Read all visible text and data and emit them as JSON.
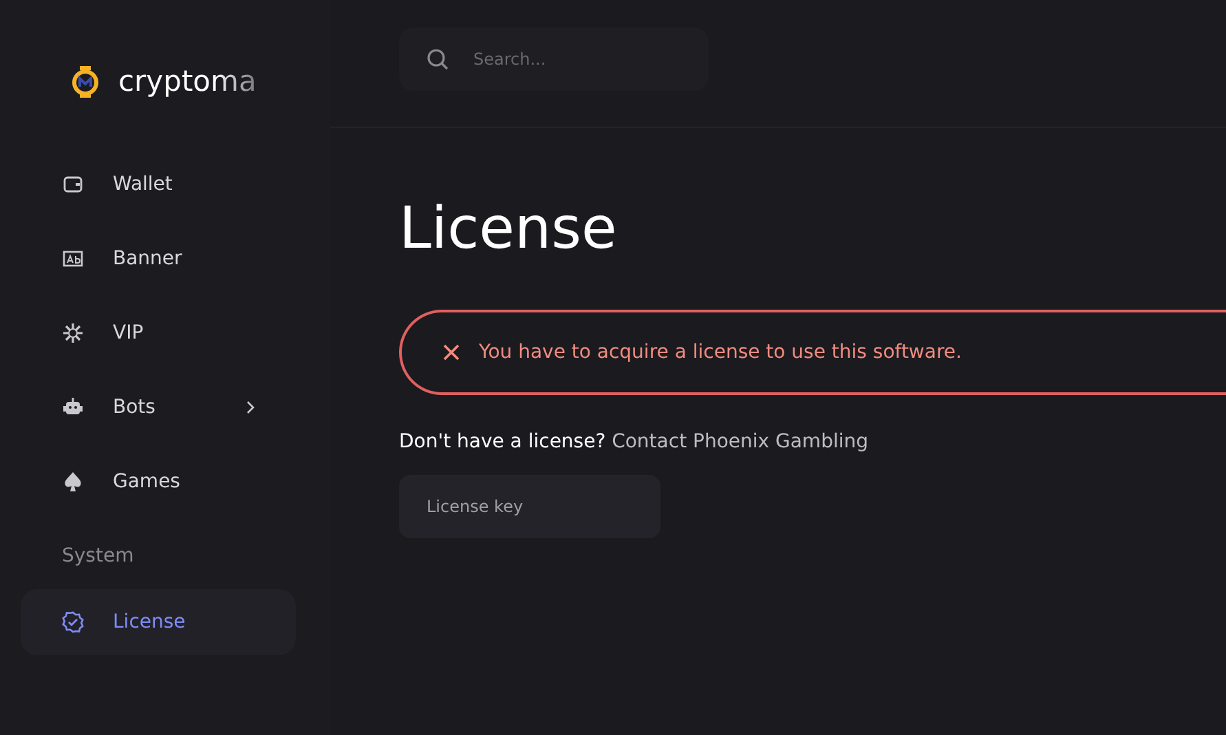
{
  "sidebar": {
    "logo": "cryptoma",
    "items": [
      {
        "label": "Wallet",
        "expandable": false,
        "selected": false
      },
      {
        "label": "Banner",
        "expandable": false,
        "selected": false
      },
      {
        "label": "VIP",
        "expandable": false,
        "selected": false
      },
      {
        "label": "Bots",
        "expandable": true,
        "selected": false
      },
      {
        "label": "Games",
        "expandable": false,
        "selected": false
      }
    ],
    "section": "System",
    "system_items": [
      {
        "label": "License",
        "expandable": false,
        "selected": true
      }
    ]
  },
  "search": {
    "placeholder": "Search..."
  },
  "page_title": "License",
  "alert": {
    "message": "You have to acquire a license to use this software."
  },
  "license_prompt": {
    "text": "Don't have a license?",
    "link": "Contact Phoenix Gambling"
  },
  "license_field": {
    "placeholder": "License key"
  }
}
